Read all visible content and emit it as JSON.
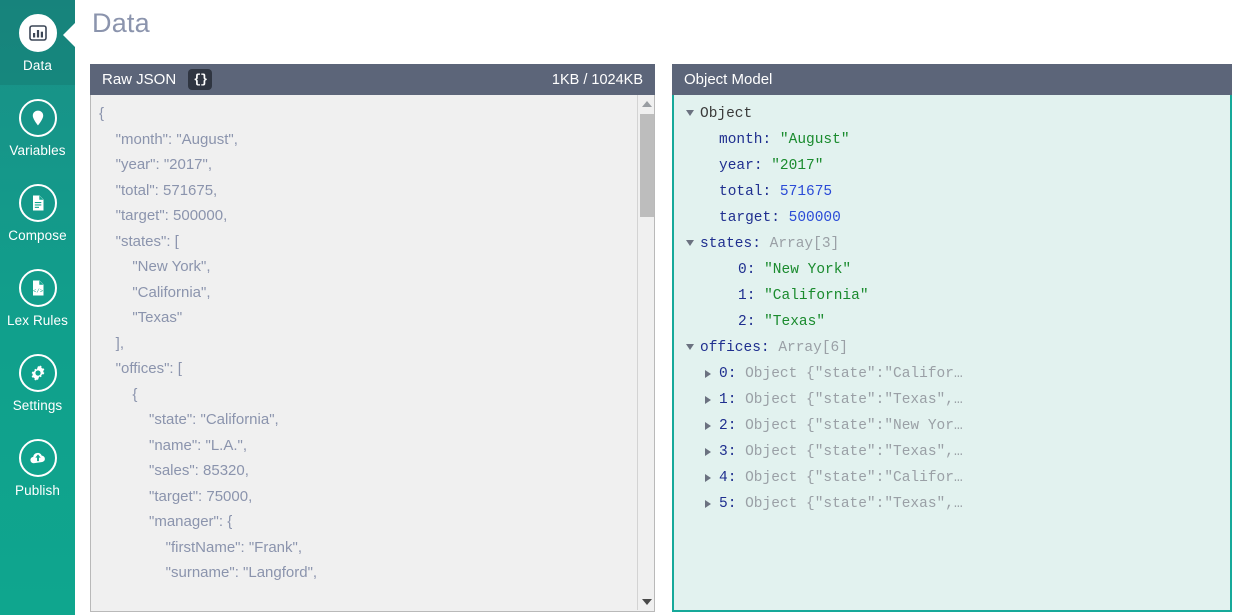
{
  "sidebar": {
    "items": [
      {
        "label": "Data",
        "icon": "chart-bar-icon",
        "active": true
      },
      {
        "label": "Variables",
        "icon": "map-pin-icon",
        "active": false
      },
      {
        "label": "Compose",
        "icon": "document-icon",
        "active": false
      },
      {
        "label": "Lex Rules",
        "icon": "document-code-icon",
        "active": false
      },
      {
        "label": "Settings",
        "icon": "gear-icon",
        "active": false
      },
      {
        "label": "Publish",
        "icon": "cloud-upload-icon",
        "active": false
      }
    ]
  },
  "header": {
    "title": "Data"
  },
  "json_panel": {
    "title": "Raw JSON",
    "format_button_label": "{}",
    "size_label": "1KB / 1024KB",
    "content": "{\n    \"month\": \"August\",\n    \"year\": \"2017\",\n    \"total\": 571675,\n    \"target\": 500000,\n    \"states\": [\n        \"New York\",\n        \"California\",\n        \"Texas\"\n    ],\n    \"offices\": [\n        {\n            \"state\": \"California\",\n            \"name\": \"L.A.\",\n            \"sales\": 85320,\n            \"target\": 75000,\n            \"manager\": {\n                \"firstName\": \"Frank\",\n                \"surname\": \"Langford\","
  },
  "object_model": {
    "title": "Object Model",
    "rows": [
      {
        "indent": 0,
        "toggle": "down",
        "key": "Object",
        "key_class": "om-root",
        "sep": "",
        "value": "",
        "value_class": ""
      },
      {
        "indent": 1,
        "toggle": "none",
        "key": "month",
        "key_class": "om-key",
        "sep": ": ",
        "value": "\"August\"",
        "value_class": "om-str"
      },
      {
        "indent": 1,
        "toggle": "none",
        "key": "year",
        "key_class": "om-key",
        "sep": ": ",
        "value": "\"2017\"",
        "value_class": "om-str"
      },
      {
        "indent": 1,
        "toggle": "none",
        "key": "total",
        "key_class": "om-key",
        "sep": ": ",
        "value": "571675",
        "value_class": "om-num"
      },
      {
        "indent": 1,
        "toggle": "none",
        "key": "target",
        "key_class": "om-key",
        "sep": ": ",
        "value": "500000",
        "value_class": "om-num"
      },
      {
        "indent": 0,
        "toggle": "down",
        "key": "states",
        "key_class": "om-key",
        "sep": ": ",
        "value": "Array[3]",
        "value_class": "om-meta"
      },
      {
        "indent": 2,
        "toggle": "none",
        "key": "0",
        "key_class": "om-key",
        "sep": ": ",
        "value": "\"New York\"",
        "value_class": "om-str"
      },
      {
        "indent": 2,
        "toggle": "none",
        "key": "1",
        "key_class": "om-key",
        "sep": ": ",
        "value": "\"California\"",
        "value_class": "om-str"
      },
      {
        "indent": 2,
        "toggle": "none",
        "key": "2",
        "key_class": "om-key",
        "sep": ": ",
        "value": "\"Texas\"",
        "value_class": "om-str"
      },
      {
        "indent": 0,
        "toggle": "down",
        "key": "offices",
        "key_class": "om-key",
        "sep": ": ",
        "value": "Array[6]",
        "value_class": "om-meta"
      },
      {
        "indent": 1,
        "toggle": "right",
        "key": "0",
        "key_class": "om-key",
        "sep": ": ",
        "value": "Object {\"state\":\"Califor…",
        "value_class": "om-obj"
      },
      {
        "indent": 1,
        "toggle": "right",
        "key": "1",
        "key_class": "om-key",
        "sep": ": ",
        "value": "Object {\"state\":\"Texas\",…",
        "value_class": "om-obj"
      },
      {
        "indent": 1,
        "toggle": "right",
        "key": "2",
        "key_class": "om-key",
        "sep": ": ",
        "value": "Object {\"state\":\"New Yor…",
        "value_class": "om-obj"
      },
      {
        "indent": 1,
        "toggle": "right",
        "key": "3",
        "key_class": "om-key",
        "sep": ": ",
        "value": "Object {\"state\":\"Texas\",…",
        "value_class": "om-obj"
      },
      {
        "indent": 1,
        "toggle": "right",
        "key": "4",
        "key_class": "om-key",
        "sep": ": ",
        "value": "Object {\"state\":\"Califor…",
        "value_class": "om-obj"
      },
      {
        "indent": 1,
        "toggle": "right",
        "key": "5",
        "key_class": "om-key",
        "sep": ": ",
        "value": "Object {\"state\":\"Texas\",…",
        "value_class": "om-obj"
      }
    ]
  },
  "colors": {
    "sidebar_teal": "#10a08c",
    "panel_header": "#5c6579",
    "object_model_border": "#16a99a",
    "object_model_bg": "#e2f2ef",
    "json_bg": "#f0f0f0",
    "json_text": "#8b94ad",
    "title_text": "#8b94ad",
    "string_value": "#1a8b2e",
    "number_value": "#2a4bd7",
    "key_text": "#1f2f8f"
  }
}
